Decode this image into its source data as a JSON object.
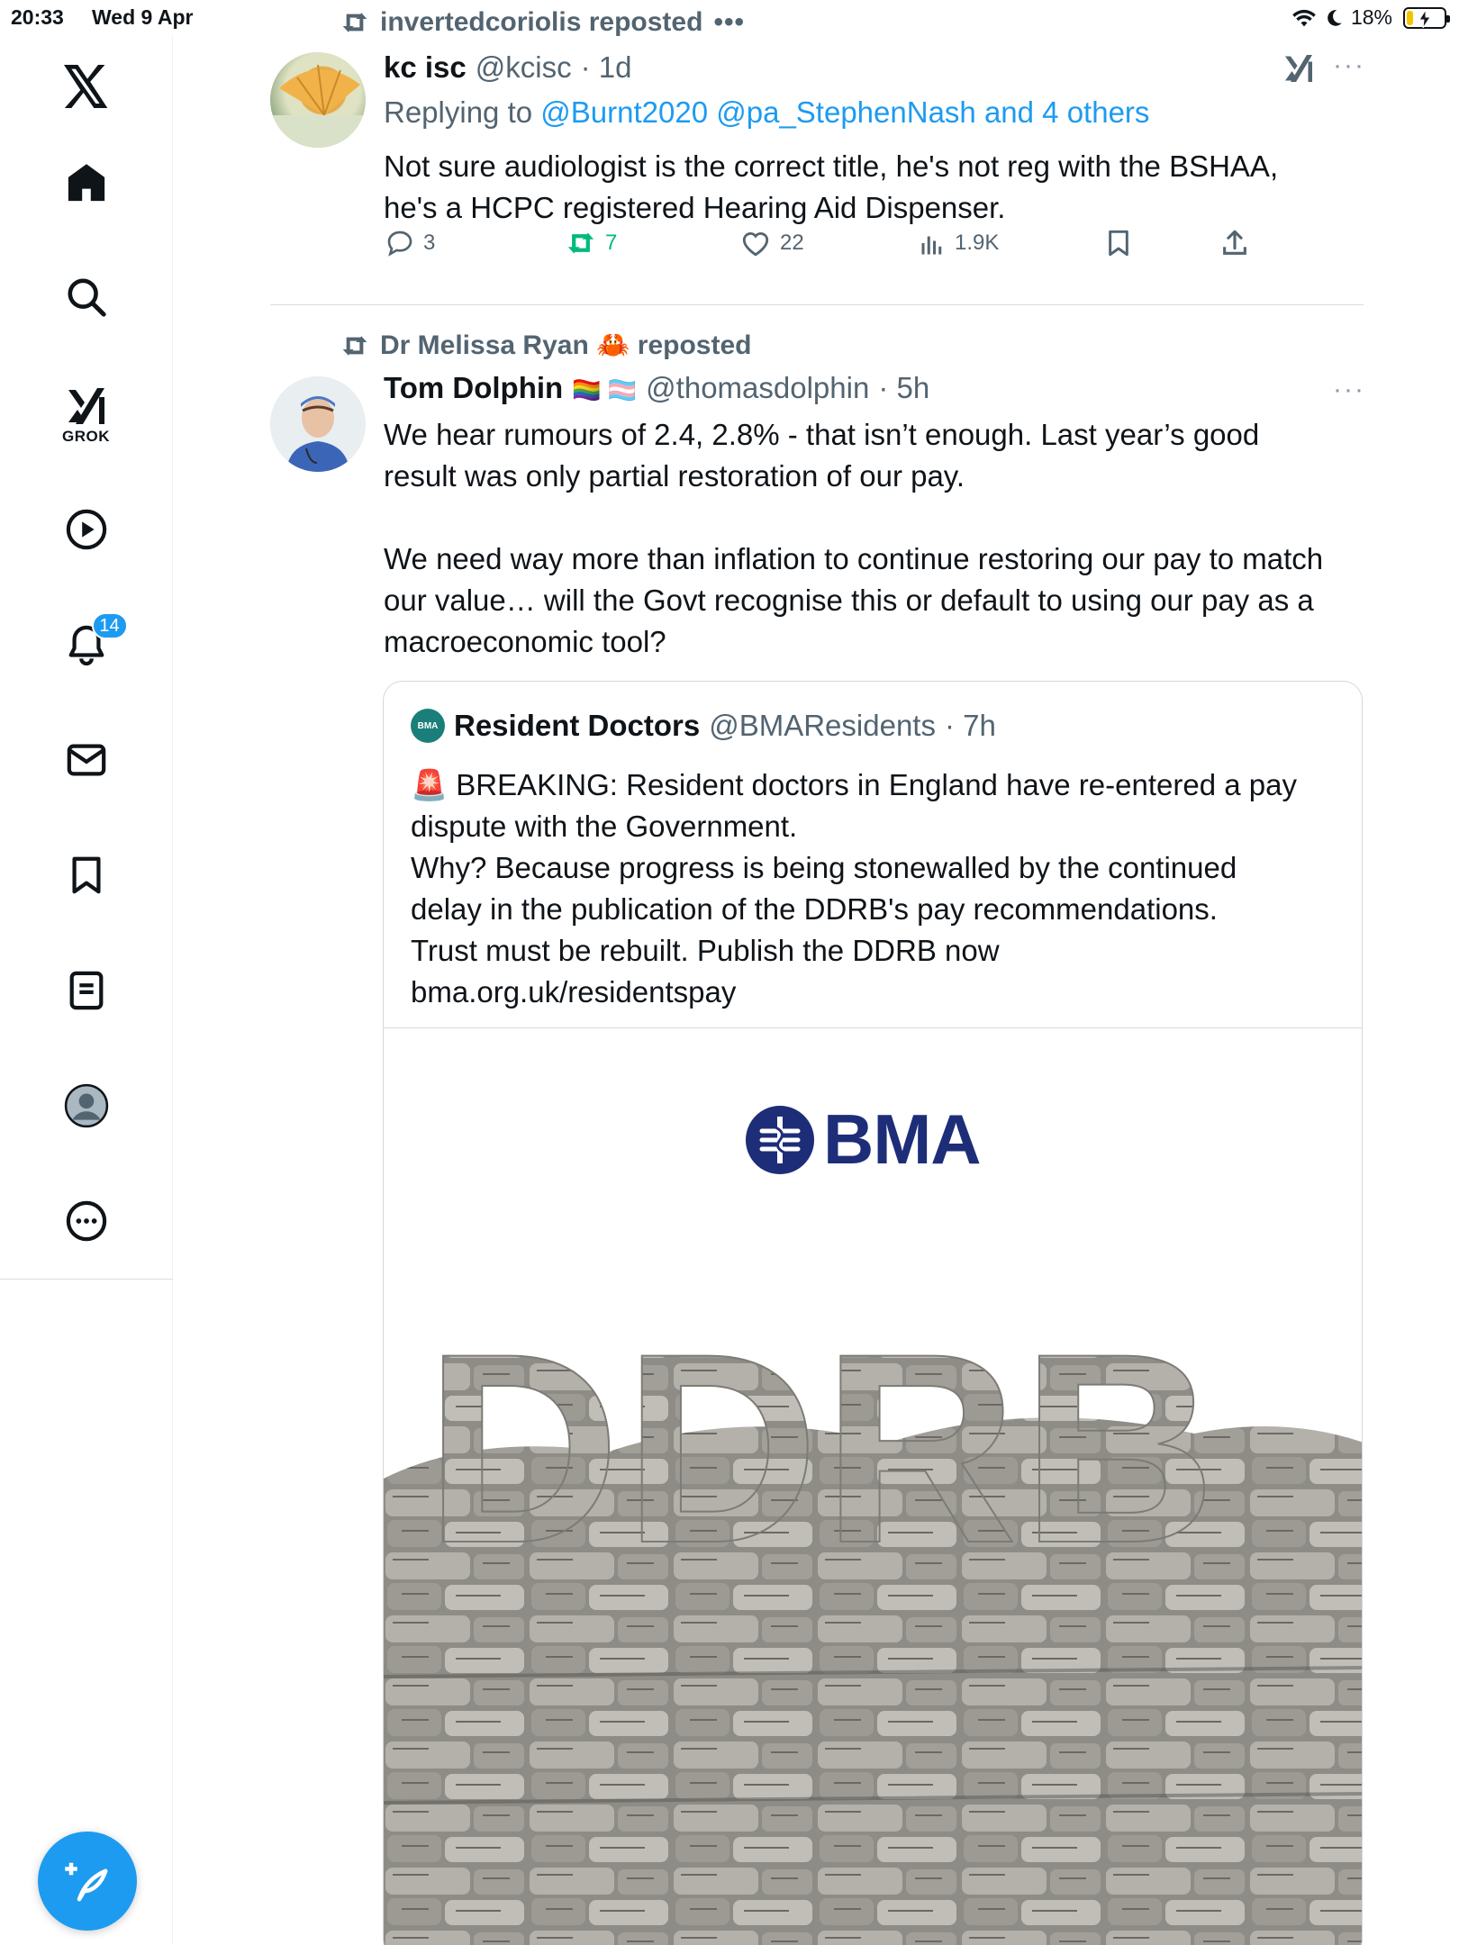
{
  "status_bar": {
    "time": "20:33",
    "date": "Wed 9 Apr",
    "battery_percent": "18%",
    "battery_level": 0.18
  },
  "sidebar": {
    "items": [
      {
        "name": "x-logo",
        "icon": "x-logo-icon"
      },
      {
        "name": "home",
        "icon": "home-icon"
      },
      {
        "name": "explore",
        "icon": "search-icon"
      },
      {
        "name": "grok",
        "icon": "grok-icon",
        "label": "GROK"
      },
      {
        "name": "video",
        "icon": "play-icon"
      },
      {
        "name": "notifications",
        "icon": "bell-icon",
        "badge": "14"
      },
      {
        "name": "messages",
        "icon": "mail-icon"
      },
      {
        "name": "bookmarks",
        "icon": "bookmark-icon"
      },
      {
        "name": "lists",
        "icon": "list-icon"
      },
      {
        "name": "profile",
        "icon": "profile-icon"
      },
      {
        "name": "more",
        "icon": "more-icon"
      }
    ],
    "compose_icon": "compose-feather-icon"
  },
  "tweets": [
    {
      "repost_by": "invertedcoriolis reposted",
      "name": "kc isc",
      "handle": "@kcisc",
      "time": "· 1d",
      "reply_prefix": "Replying to",
      "reply_mentions": "@Burnt2020 @pa_StephenNash and 4 others",
      "text_lines": [
        "Not sure audiologist is the correct title, he's not reg with the BSHAA,",
        "he's a HCPC registered Hearing Aid Dispenser."
      ],
      "replies": "3",
      "reposts": "7",
      "likes": "22",
      "views": "1.9K",
      "reposted_by_viewer": true
    },
    {
      "repost_by": "Dr Melissa Ryan 🦀 reposted",
      "name": "Tom Dolphin",
      "name_flags": "🏳️‍🌈 🏳️‍⚧️",
      "handle": "@thomasdolphin",
      "time": "· 5h",
      "text_lines": [
        "We hear rumours of 2.4, 2.8% - that isn’t enough. Last year’s good",
        "result was only partial restoration of our pay.",
        "",
        "We need way more than inflation to continue restoring our pay to match",
        "our value… will the Govt recognise this or default to using our pay as a",
        "macroeconomic tool?"
      ],
      "quote": {
        "avatar_text": "BMA",
        "name": "Resident Doctors",
        "handle": "@BMAResidents",
        "time": "· 7h",
        "text_lines": [
          "🚨 BREAKING: Resident doctors in England have re-entered a pay",
          "dispute with the Government.",
          "Why? Because progress is being stonewalled by the continued",
          "delay in the publication of the DDRB's pay recommendations.",
          "Trust must be rebuilt. Publish the DDRB now",
          "bma.org.uk/residentspay"
        ],
        "media": {
          "logo_text": "BMA",
          "headline": "DDRB"
        }
      }
    }
  ],
  "colors": {
    "accent": "#1d9bf0",
    "repost_green": "#00ba7c",
    "muted": "#536471",
    "bma_navy": "#1e2d78"
  }
}
